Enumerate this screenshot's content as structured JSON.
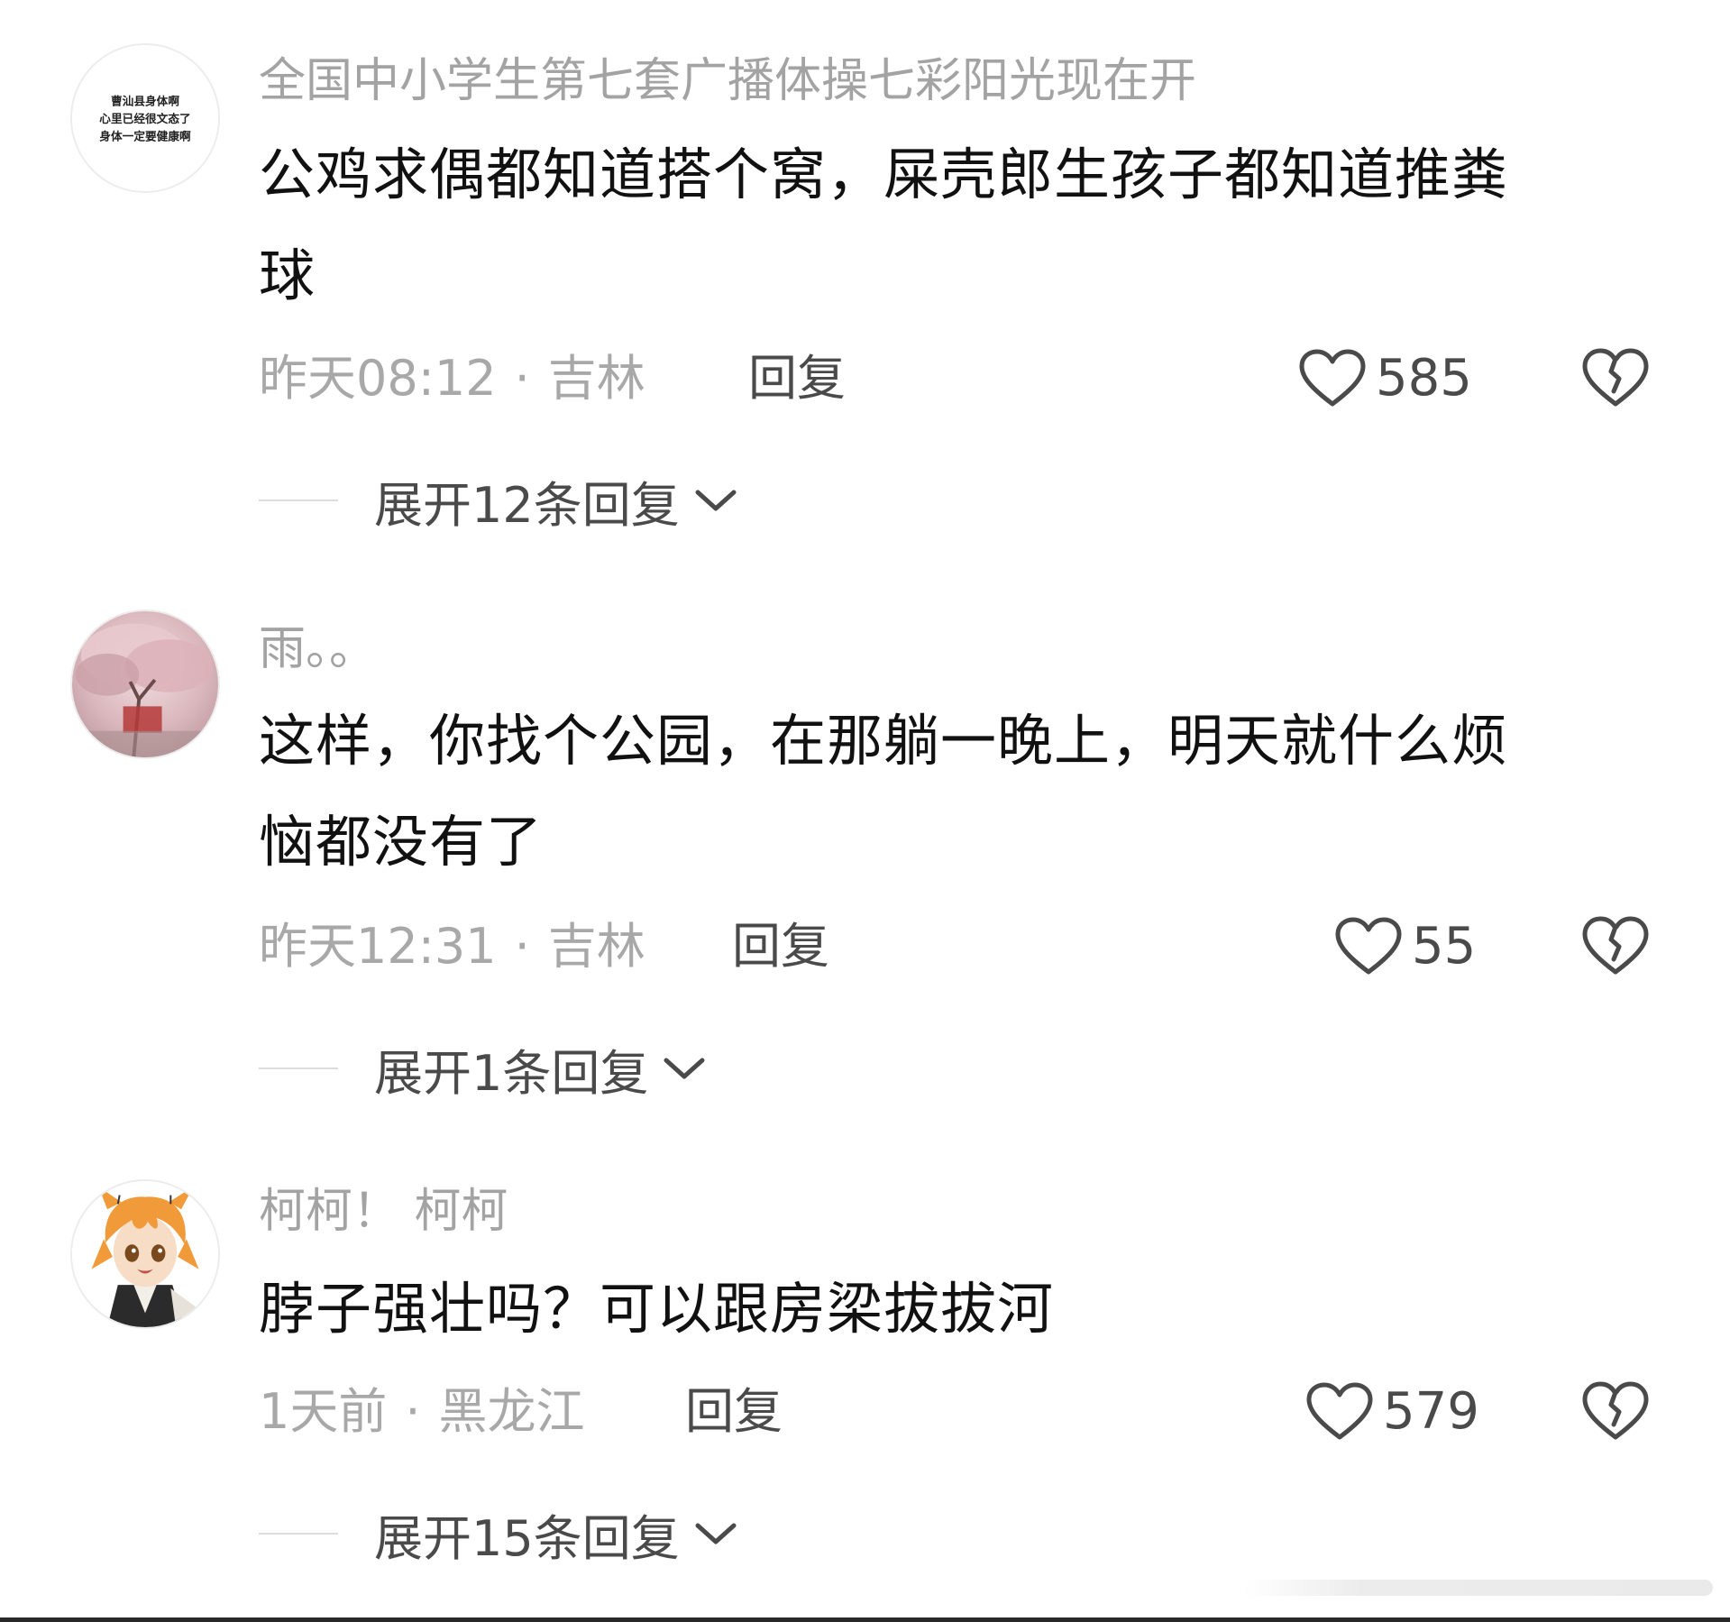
{
  "comments": [
    {
      "username": "全国中小学生第七套广播体操七彩阳光现在开",
      "avatar": {
        "type": "text-logo",
        "lines": [
          "曹汕县身体啊",
          "心里已经很文态了",
          "身体一定要健康啊"
        ]
      },
      "content_lines": [
        "公鸡求偶都知道搭个窝，屎壳郎生孩子都知道推粪",
        "球"
      ],
      "time": "昨天08:12",
      "separator": "·",
      "location": "吉林",
      "reply_label": "回复",
      "likes": "585",
      "expand_label": "展开12条回复"
    },
    {
      "username": "雨。。",
      "avatar": {
        "type": "photo",
        "subject": "pink-cherry-blossom-tree"
      },
      "content_lines": [
        "这样，你找个公园，在那躺一晚上，明天就什么烦",
        "恼都没有了"
      ],
      "time": "昨天12:31",
      "separator": "·",
      "location": "吉林",
      "reply_label": "回复",
      "likes": "55",
      "expand_label": "展开1条回复"
    },
    {
      "username": "柯柯！ 柯柯",
      "avatar": {
        "type": "anime-illustration",
        "subject": "orange-haired-anime-character"
      },
      "content_lines": [
        "脖子强壮吗？可以跟房梁拔拔河"
      ],
      "time": "1天前",
      "separator": "·",
      "location": "黑龙江",
      "reply_label": "回复",
      "likes": "579",
      "expand_label": "展开15条回复"
    }
  ],
  "icons": {
    "like": "heart-outline-icon",
    "dislike": "broken-heart-icon",
    "expand": "chevron-down-icon"
  },
  "colors": {
    "username": "#a3a3a3",
    "content": "#111111",
    "meta": "#a8a8a8",
    "action": "#4a4a4a",
    "divider": "#dcdcdc",
    "background": "#ffffff"
  }
}
